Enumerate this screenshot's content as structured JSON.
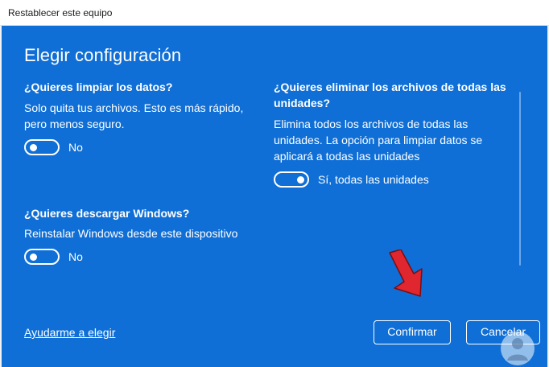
{
  "window": {
    "title": "Restablecer este equipo"
  },
  "heading": "Elegir configuración",
  "clean_data": {
    "question": "¿Quieres limpiar los datos?",
    "description_line1": "Solo quita tus archivos. Esto es más rápido,",
    "description_line2": "pero menos seguro.",
    "toggle_state": "off",
    "toggle_label": "No"
  },
  "download_windows": {
    "question": "¿Quieres descargar Windows?",
    "description": "Reinstalar Windows desde este dispositivo",
    "toggle_state": "off",
    "toggle_label": "No"
  },
  "delete_drives": {
    "question_line1": "¿Quieres eliminar los archivos de todas las",
    "question_line2": "unidades?",
    "description_line1": "Elimina todos los archivos de todas las",
    "description_line2": "unidades. La opción para limpiar datos se",
    "description_line3": "aplicará a todas las unidades",
    "toggle_state": "on",
    "toggle_label": "Sí, todas las unidades"
  },
  "footer": {
    "help_link": "Ayudarme a elegir",
    "confirm_label": "Confirmar",
    "cancel_label": "Cancelar"
  },
  "colors": {
    "panel_background": "#0f6fd6",
    "arrow": "#e0262e"
  }
}
